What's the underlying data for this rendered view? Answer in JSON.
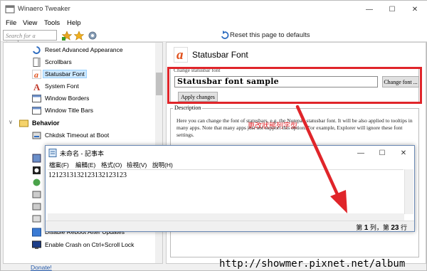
{
  "window": {
    "title": "Winaero Tweaker"
  },
  "menu": [
    "File",
    "View",
    "Tools",
    "Help"
  ],
  "toolbar": {
    "search_placeholder": "Search for a tweak...",
    "reset_label": "Reset this page to defaults"
  },
  "tree": {
    "items": [
      {
        "label": "Reset Advanced Appearance",
        "icon": "reset-icon"
      },
      {
        "label": "Scrollbars",
        "icon": "scrollbar-icon"
      },
      {
        "label": "Statusbar Font",
        "icon": "font-a-icon",
        "selected": true
      },
      {
        "label": "System Font",
        "icon": "font-a-icon"
      },
      {
        "label": "Window Borders",
        "icon": "window-icon"
      },
      {
        "label": "Window Title Bars",
        "icon": "window-icon"
      }
    ],
    "group": "Behavior",
    "behavior_items": [
      {
        "label": "Chkdsk Timeout at Boot"
      },
      {
        "label": "Disable Reboot After Updates"
      },
      {
        "label": "Enable Crash on Ctrl+Scroll Lock"
      }
    ],
    "bottom_link": "Donate!"
  },
  "right": {
    "page_title": "Statusbar Font",
    "group_label": "Change statusbar font",
    "sample_text": "Statusbar font sample",
    "change_font_button": "Change font ...",
    "apply_button": "Apply changes",
    "annotation": "更改狀態列字型",
    "desc_label": "Description",
    "desc_text": "Here you can change the font of statusbars, e.g. the Notepad statusbar font. It will be also applied to tooltips in many apps. Note that many apps just not support this option. For example, Explorer will ignore these font settings."
  },
  "notepad": {
    "title": "未命名 - 記事本",
    "menu": [
      "檔案(F)",
      "編輯(E)",
      "格式(O)",
      "檢視(V)",
      "說明(H)"
    ],
    "content": "1212313132123132123123",
    "status_prefix": "第",
    "status_line": "1",
    "status_mid": "列，第",
    "status_col": "23",
    "status_suffix": "行"
  },
  "watermark": "http://showmer.pixnet.net/album",
  "colors": {
    "annotation": "#e0252a",
    "selection": "#cce8ff"
  }
}
